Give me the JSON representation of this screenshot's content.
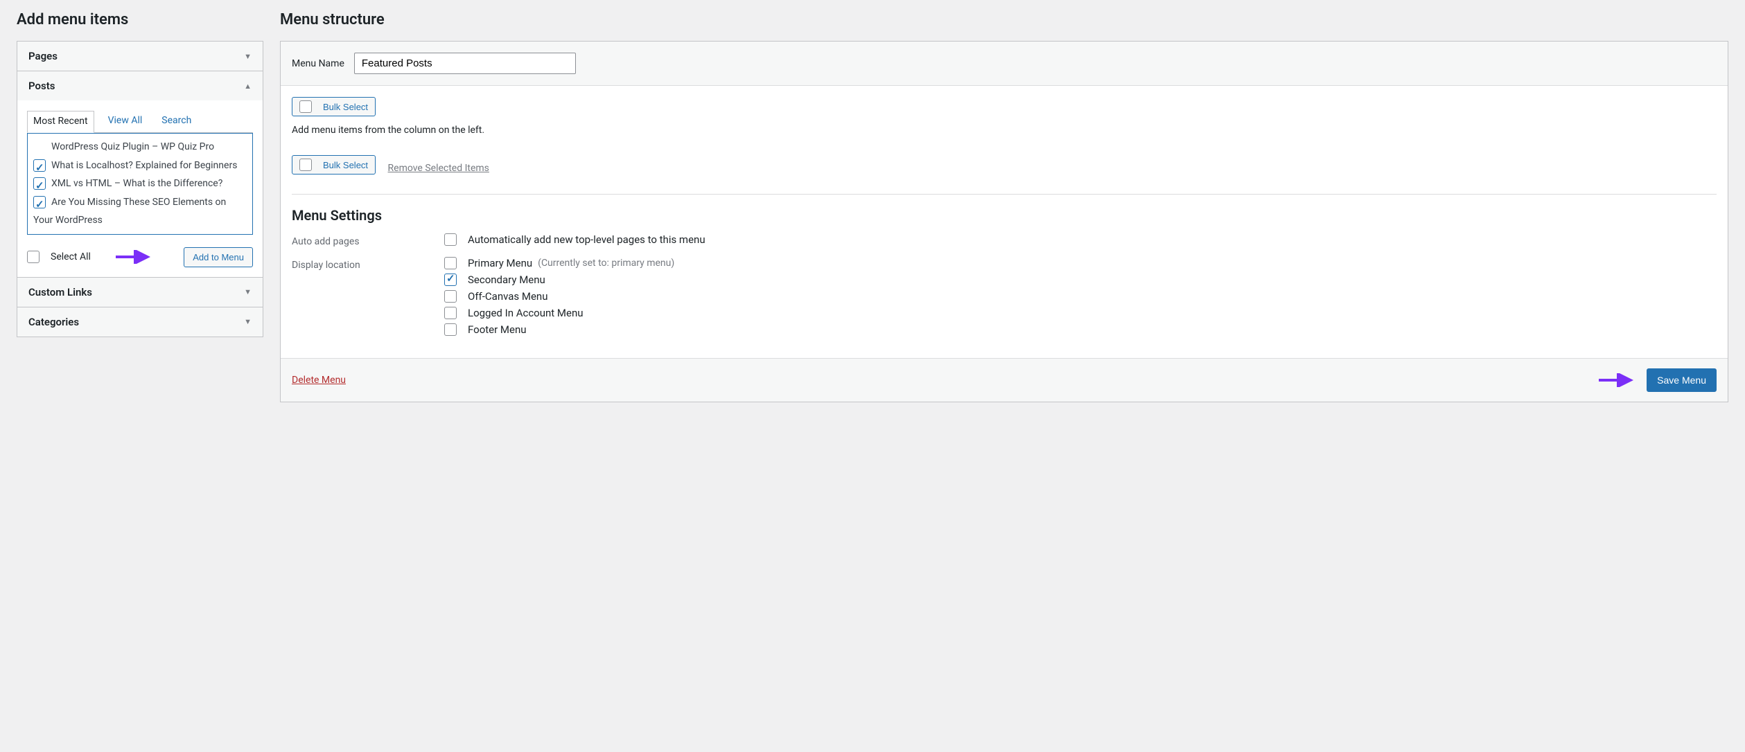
{
  "left": {
    "title": "Add menu items",
    "sections": {
      "pages": "Pages",
      "posts": "Posts",
      "custom_links": "Custom Links",
      "categories": "Categories"
    },
    "tabs": {
      "recent": "Most Recent",
      "view_all": "View All",
      "search": "Search"
    },
    "posts": [
      {
        "label": "WordPress Quiz Plugin – WP Quiz Pro",
        "checked": false
      },
      {
        "label": "What is Localhost? Explained for Beginners",
        "checked": true
      },
      {
        "label": "XML vs HTML – What is the Difference?",
        "checked": true
      },
      {
        "label": "Are You Missing These SEO Elements on Your WordPress",
        "checked": true
      }
    ],
    "select_all": "Select All",
    "add_to_menu": "Add to Menu"
  },
  "right": {
    "title": "Menu structure",
    "menu_name_label": "Menu Name",
    "menu_name_value": "Featured Posts",
    "bulk_select": "Bulk Select",
    "hint": "Add menu items from the column on the left.",
    "remove_selected": "Remove Selected Items",
    "settings_title": "Menu Settings",
    "auto_add_label": "Auto add pages",
    "auto_add_option": "Automatically add new top-level pages to this menu",
    "display_label": "Display location",
    "locations": [
      {
        "label": "Primary Menu",
        "checked": false,
        "hint": "(Currently set to: primary menu)"
      },
      {
        "label": "Secondary Menu",
        "checked": true,
        "hint": ""
      },
      {
        "label": "Off-Canvas Menu",
        "checked": false,
        "hint": ""
      },
      {
        "label": "Logged In Account Menu",
        "checked": false,
        "hint": ""
      },
      {
        "label": "Footer Menu",
        "checked": false,
        "hint": ""
      }
    ],
    "delete_menu": "Delete Menu",
    "save_menu": "Save Menu"
  }
}
